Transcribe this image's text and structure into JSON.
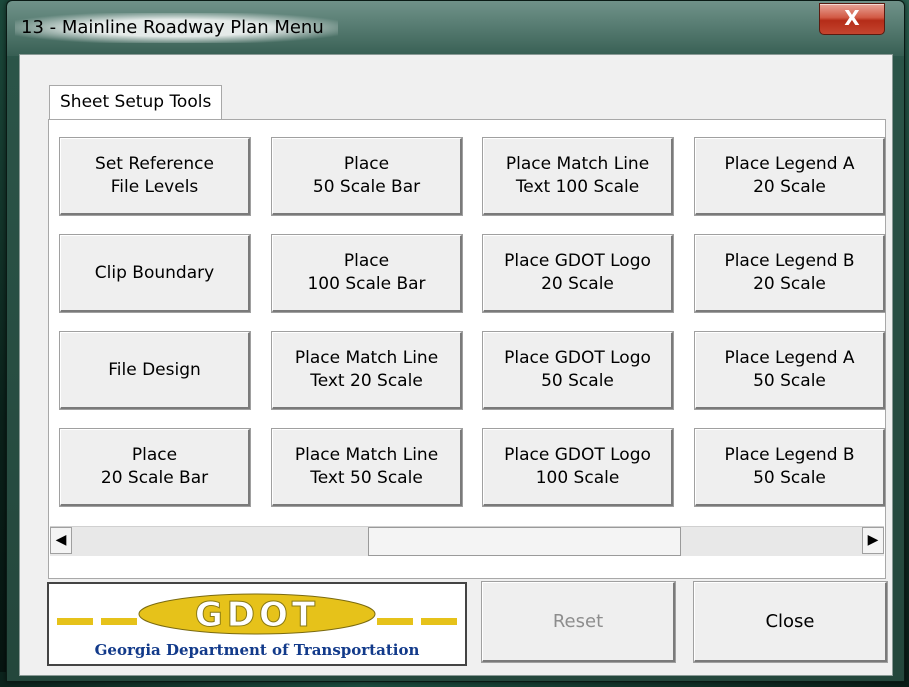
{
  "window": {
    "title": "13 - Mainline Roadway Plan Menu",
    "close_glyph": "X"
  },
  "tabs": [
    {
      "label": "Sheet Setup Tools"
    }
  ],
  "buttons": [
    {
      "label": "Set Reference\nFile Levels"
    },
    {
      "label": "Place\n50 Scale Bar"
    },
    {
      "label": "Place Match Line\nText 100 Scale"
    },
    {
      "label": "Place Legend A\n20 Scale"
    },
    {
      "label": "Clip Boundary"
    },
    {
      "label": "Place\n100 Scale Bar"
    },
    {
      "label": "Place GDOT Logo\n20 Scale"
    },
    {
      "label": "Place Legend B\n20 Scale"
    },
    {
      "label": "File Design"
    },
    {
      "label": "Place Match Line\nText 20 Scale"
    },
    {
      "label": "Place GDOT Logo\n50 Scale"
    },
    {
      "label": "Place Legend A\n50 Scale"
    },
    {
      "label": "Place\n20 Scale Bar"
    },
    {
      "label": "Place Match Line\nText 50 Scale"
    },
    {
      "label": "Place GDOT Logo\n100 Scale"
    },
    {
      "label": "Place Legend B\n50 Scale"
    }
  ],
  "scrollbar": {
    "left_arrow": "◀",
    "right_arrow": "▶"
  },
  "logo": {
    "wordmark": "GDOT",
    "subtitle": "Georgia Department of Transportation"
  },
  "footer": {
    "reset_label": "Reset",
    "close_label": "Close",
    "reset_enabled": false
  },
  "colors": {
    "logo_gold": "#e6c21a",
    "logo_blue": "#123a8a",
    "disabled_text": "#8d8d8d"
  }
}
